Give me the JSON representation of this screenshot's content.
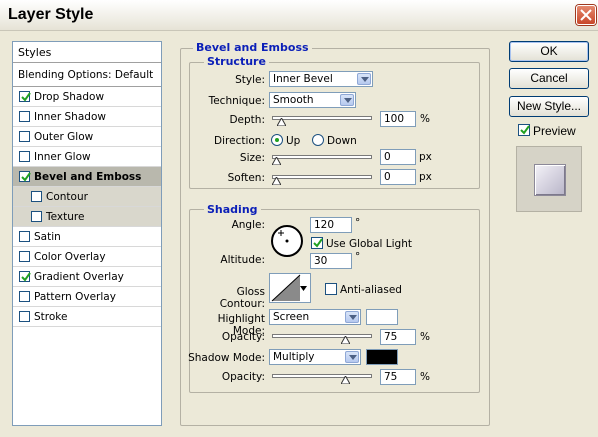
{
  "window": {
    "title": "Layer Style"
  },
  "styles_panel": {
    "header": "Styles",
    "blending": "Blending Options: Default",
    "items": [
      {
        "label": "Drop Shadow",
        "checked": true,
        "sub": false,
        "selected": false
      },
      {
        "label": "Inner Shadow",
        "checked": false,
        "sub": false,
        "selected": false
      },
      {
        "label": "Outer Glow",
        "checked": false,
        "sub": false,
        "selected": false
      },
      {
        "label": "Inner Glow",
        "checked": false,
        "sub": false,
        "selected": false
      },
      {
        "label": "Bevel and Emboss",
        "checked": true,
        "sub": false,
        "selected": true
      },
      {
        "label": "Contour",
        "checked": false,
        "sub": true,
        "selected": false
      },
      {
        "label": "Texture",
        "checked": false,
        "sub": true,
        "selected": false
      },
      {
        "label": "Satin",
        "checked": false,
        "sub": false,
        "selected": false
      },
      {
        "label": "Color Overlay",
        "checked": false,
        "sub": false,
        "selected": false
      },
      {
        "label": "Gradient Overlay",
        "checked": true,
        "sub": false,
        "selected": false
      },
      {
        "label": "Pattern Overlay",
        "checked": false,
        "sub": false,
        "selected": false
      },
      {
        "label": "Stroke",
        "checked": false,
        "sub": false,
        "selected": false
      }
    ]
  },
  "bevel": {
    "group_title": "Bevel and Emboss",
    "structure": {
      "title": "Structure",
      "style_label": "Style:",
      "style_value": "Inner Bevel",
      "technique_label": "Technique:",
      "technique_value": "Smooth",
      "depth_label": "Depth:",
      "depth_value": "100",
      "depth_unit": "%",
      "direction_label": "Direction:",
      "direction_up": "Up",
      "direction_down": "Down",
      "direction_selected": "Up",
      "size_label": "Size:",
      "size_value": "0",
      "size_unit": "px",
      "soften_label": "Soften:",
      "soften_value": "0",
      "soften_unit": "px"
    },
    "shading": {
      "title": "Shading",
      "angle_label": "Angle:",
      "angle_value": "120",
      "angle_unit": "°",
      "global_light_label": "Use Global Light",
      "global_light_checked": true,
      "altitude_label": "Altitude:",
      "altitude_value": "30",
      "altitude_unit": "°",
      "gloss_label": "Gloss Contour:",
      "anti_aliased_label": "Anti-aliased",
      "anti_aliased_checked": false,
      "highlight_mode_label": "Highlight Mode:",
      "highlight_mode_value": "Screen",
      "highlight_color": "#ffffff",
      "highlight_opacity_label": "Opacity:",
      "highlight_opacity_value": "75",
      "highlight_opacity_unit": "%",
      "shadow_mode_label": "Shadow Mode:",
      "shadow_mode_value": "Multiply",
      "shadow_color": "#000000",
      "shadow_opacity_label": "Opacity:",
      "shadow_opacity_value": "75",
      "shadow_opacity_unit": "%"
    }
  },
  "buttons": {
    "ok": "OK",
    "cancel": "Cancel",
    "new_style": "New Style...",
    "preview_label": "Preview",
    "preview_checked": true
  },
  "sliders": {
    "depth_fraction": 0.05,
    "size_fraction": 0.0,
    "soften_fraction": 0.0,
    "highlight_opacity_fraction": 0.75,
    "shadow_opacity_fraction": 0.75
  },
  "colors": {
    "group_title": "#0b1fb8",
    "accent_check": "#21a121"
  }
}
